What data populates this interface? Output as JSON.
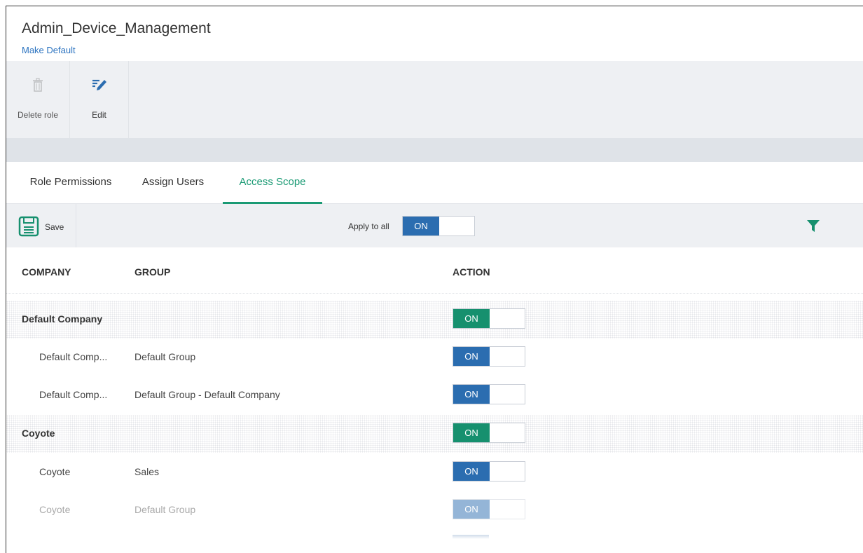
{
  "header": {
    "title": "Admin_Device_Management",
    "make_default": "Make Default"
  },
  "toolbar": {
    "delete_label": "Delete role",
    "edit_label": "Edit"
  },
  "tabs": [
    {
      "label": "Role Permissions",
      "active": false
    },
    {
      "label": "Assign Users",
      "active": false
    },
    {
      "label": "Access Scope",
      "active": true
    }
  ],
  "actionbar": {
    "save_label": "Save",
    "apply_to_all_label": "Apply to all",
    "apply_to_all_value": "ON"
  },
  "table": {
    "headers": {
      "company": "COMPANY",
      "group": "GROUP",
      "action": "ACTION"
    },
    "rows": [
      {
        "company": "Default Company",
        "group": "",
        "action": "ON",
        "type": "company"
      },
      {
        "company": "Default Comp...",
        "group": "Default Group",
        "action": "ON",
        "type": "group"
      },
      {
        "company": "Default Comp...",
        "group": "Default Group - Default Company",
        "action": "ON",
        "type": "group"
      },
      {
        "company": "Coyote",
        "group": "",
        "action": "ON",
        "type": "company"
      },
      {
        "company": "Coyote",
        "group": "Sales",
        "action": "ON",
        "type": "group"
      },
      {
        "company": "Coyote",
        "group": "Default Group",
        "action": "ON",
        "type": "group"
      }
    ]
  },
  "colors": {
    "accent_green": "#16906e",
    "toggle_blue": "#2b6db0",
    "link_blue": "#2b73c0",
    "toolbar_bg": "#eef0f3"
  },
  "icons": {
    "delete": "trash-icon",
    "edit": "edit-pencil-icon",
    "save": "save-disk-icon",
    "filter": "filter-funnel-icon"
  }
}
